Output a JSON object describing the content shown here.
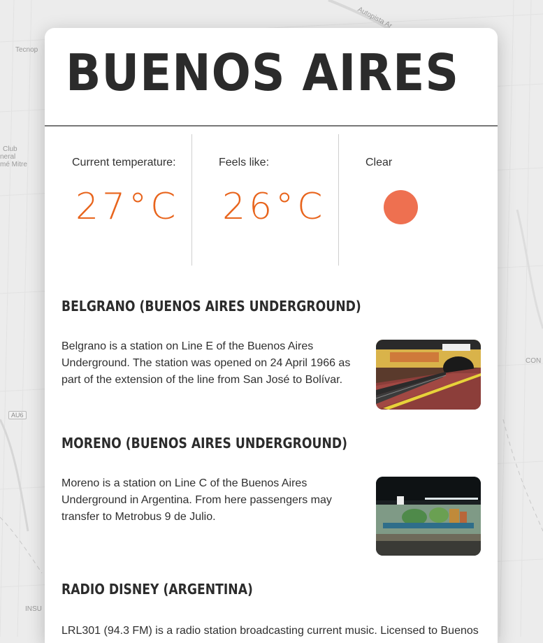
{
  "map": {
    "labels": [
      "Tecnop",
      "Club",
      "neral",
      "mé Mitre",
      "Autopista Ar",
      "CON",
      "INSU"
    ],
    "shield": "AU6"
  },
  "city": {
    "name": "BUENOS AIRES"
  },
  "weather": {
    "current_label": "Current temperature:",
    "current_value": "27°C",
    "feels_label": "Feels like:",
    "feels_value": "26°C",
    "condition_label": "Clear",
    "condition_icon": "sun-icon",
    "accent_color": "#e8641c",
    "sun_color": "#ee7050"
  },
  "articles": [
    {
      "title": "BELGRANO (BUENOS AIRES UNDERGROUND)",
      "text": "Belgrano is a station on Line E of the Buenos Aires Underground. The station was opened on 24 April 1966 as part of the extension of the line from San José to Bolívar."
    },
    {
      "title": "MORENO (BUENOS AIRES UNDERGROUND)",
      "text": "Moreno is a station on Line C of the Buenos Aires Underground in Argentina. From here passengers may transfer to Metrobus 9 de Julio."
    },
    {
      "title": "RADIO DISNEY (ARGENTINA)",
      "text": "LRL301 (94.3 FM) is a radio station broadcasting current music. Licensed to Buenos"
    }
  ]
}
